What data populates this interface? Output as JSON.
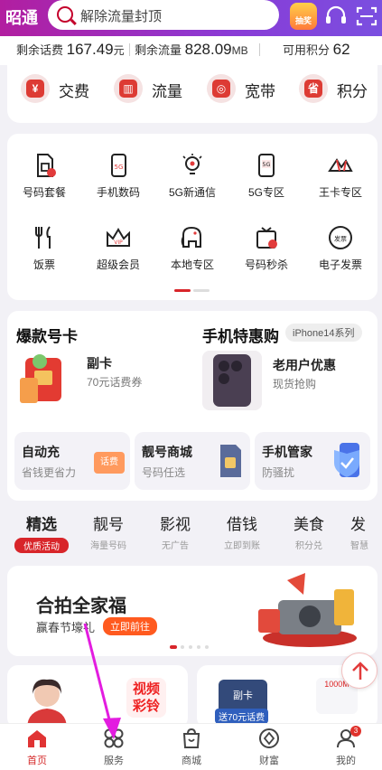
{
  "header": {
    "city": "昭通",
    "search_placeholder": "解除流量封顶",
    "lottery_label": "抽奖",
    "service_icon": "headset-icon",
    "scan_icon": "scan-icon"
  },
  "balance": {
    "fee_label": "剩余话费",
    "fee_value": "167.49",
    "fee_unit": "元",
    "flow_label": "剩余流量",
    "flow_value": "828.09",
    "flow_unit": "MB",
    "points_label": "可用积分",
    "points_value": "62"
  },
  "quick": [
    {
      "label": "交费",
      "icon": "¥"
    },
    {
      "label": "流量",
      "icon": "▥"
    },
    {
      "label": "宽带",
      "icon": "◎"
    },
    {
      "label": "积分",
      "icon": "省"
    }
  ],
  "grid": [
    {
      "label": "号码套餐"
    },
    {
      "label": "手机数码"
    },
    {
      "label": "5G新通信"
    },
    {
      "label": "5G专区"
    },
    {
      "label": "王卡专区"
    },
    {
      "label": "饭票"
    },
    {
      "label": "超级会员"
    },
    {
      "label": "本地专区"
    },
    {
      "label": "号码秒杀"
    },
    {
      "label": "电子发票"
    }
  ],
  "grid_icon_text": {
    "g1": "5G",
    "g3": "5G",
    "g6": "VIP",
    "g9": "发票"
  },
  "panel": {
    "left_title": "爆款号卡",
    "left_item_title": "副卡",
    "left_item_sub": "70元话费券",
    "right_title": "手机特惠购",
    "right_tag": "iPhone14系列",
    "right_item_title": "老用户优惠",
    "right_item_sub": "现货抢购",
    "cards": [
      {
        "title": "自动充",
        "sub": "省钱更省力",
        "badge": "话费"
      },
      {
        "title": "靓号商城",
        "sub": "号码任选"
      },
      {
        "title": "手机管家",
        "sub": "防骚扰"
      }
    ]
  },
  "tabs": [
    {
      "title": "精选",
      "sub": "优质活动"
    },
    {
      "title": "靓号",
      "sub": "海量号码"
    },
    {
      "title": "影视",
      "sub": "无广告"
    },
    {
      "title": "借钱",
      "sub": "立即到账"
    },
    {
      "title": "美食",
      "sub": "积分兑"
    },
    {
      "title": "发",
      "sub": "智慧"
    }
  ],
  "banner": {
    "title": "合拍全家福",
    "subtitle": "赢春节壕礼",
    "button": "立即前往"
  },
  "feed": {
    "video_label": "视频彩铃",
    "card_label": "副卡",
    "card_sub": "送70元话费",
    "router_label": "1000M"
  },
  "nav": [
    {
      "label": "首页"
    },
    {
      "label": "服务"
    },
    {
      "label": "商城"
    },
    {
      "label": "财富"
    },
    {
      "label": "我的",
      "badge": "3"
    }
  ],
  "colors": {
    "brand_red": "#d8252a",
    "header_gradient_start": "#b21ea0",
    "header_gradient_end": "#7a4fe0",
    "annotation_arrow": "#e31ce0"
  }
}
